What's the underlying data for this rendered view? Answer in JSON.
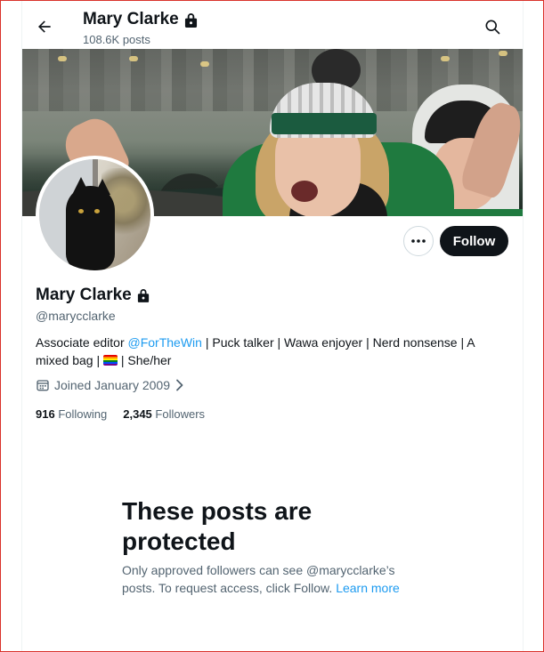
{
  "header": {
    "title": "Mary Clarke",
    "post_count": "108.6K posts"
  },
  "profile": {
    "name": "Mary Clarke",
    "handle": "@marycclarke",
    "bio_prefix": "Associate editor ",
    "bio_link": "@ForTheWin",
    "bio_middle": " | Puck talker | Wawa enjoyer | Nerd nonsense | A mixed bag | ",
    "bio_suffix": " | She/her",
    "joined": "Joined January 2009",
    "following_count": "916",
    "following_label": "Following",
    "followers_count": "2,345",
    "followers_label": "Followers"
  },
  "actions": {
    "follow_label": "Follow"
  },
  "protected": {
    "title": "These posts are protected",
    "text": "Only approved followers can see @marycclarke’s posts. To request access, click Follow. ",
    "learn_more": "Learn more"
  },
  "colors": {
    "accent": "#1d9bf0",
    "text": "#0f1419",
    "muted": "#536471",
    "button": "#0f1419"
  },
  "icons": [
    "back-arrow-icon",
    "lock-icon",
    "search-icon",
    "more-icon",
    "calendar-icon",
    "chevron-right-icon",
    "pride-flag-icon"
  ]
}
